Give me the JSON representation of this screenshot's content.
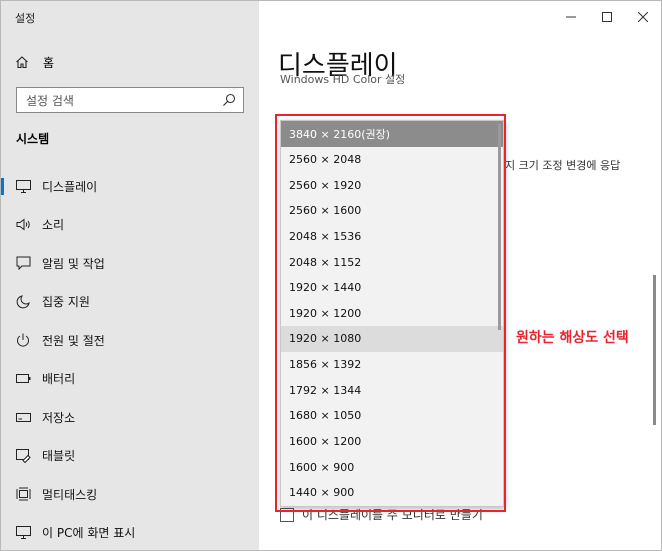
{
  "window": {
    "title": "설정"
  },
  "sidebar": {
    "home_label": "홈",
    "search_placeholder": "설정 검색",
    "section_title": "시스템",
    "items": [
      {
        "label": "디스플레이",
        "icon": "monitor-icon",
        "selected": true
      },
      {
        "label": "소리",
        "icon": "speaker-icon"
      },
      {
        "label": "알림 및 작업",
        "icon": "notification-icon"
      },
      {
        "label": "집중 지원",
        "icon": "moon-icon"
      },
      {
        "label": "전원 및 절전",
        "icon": "power-icon"
      },
      {
        "label": "배터리",
        "icon": "battery-icon"
      },
      {
        "label": "저장소",
        "icon": "storage-icon"
      },
      {
        "label": "태블릿",
        "icon": "tablet-icon"
      },
      {
        "label": "멀티태스킹",
        "icon": "multitasking-icon"
      },
      {
        "label": "이 PC에 화면 표시",
        "icon": "project-icon"
      }
    ]
  },
  "main": {
    "title": "디스플레이",
    "partial_header": "Windows HD Color 설정",
    "behind_text": "지 크기 조정 변경에 응답",
    "checkbox_label": "이 디스플레이를 주 모니터로 만들기"
  },
  "dropdown": {
    "options": [
      "3840 × 2160(권장)",
      "2560 × 2048",
      "2560 × 1920",
      "2560 × 1600",
      "2048 × 1536",
      "2048 × 1152",
      "1920 × 1440",
      "1920 × 1200",
      "1920 × 1080",
      "1856 × 1392",
      "1792 × 1344",
      "1680 × 1050",
      "1600 × 1200",
      "1600 × 900",
      "1440 × 900"
    ],
    "selected_option": "3840 × 2160(권장)",
    "hovered_option": "1920 × 1080"
  },
  "annotation": {
    "text": "원하는 해상도 선택",
    "color": "#e8242f"
  },
  "colors": {
    "accent": "#0078d7",
    "sidebar_bg": "#e6e6e6",
    "dropdown_bg": "#f2f2f2",
    "selected_bg": "#8c8c8c",
    "hover_bg": "#dcdcdc"
  }
}
